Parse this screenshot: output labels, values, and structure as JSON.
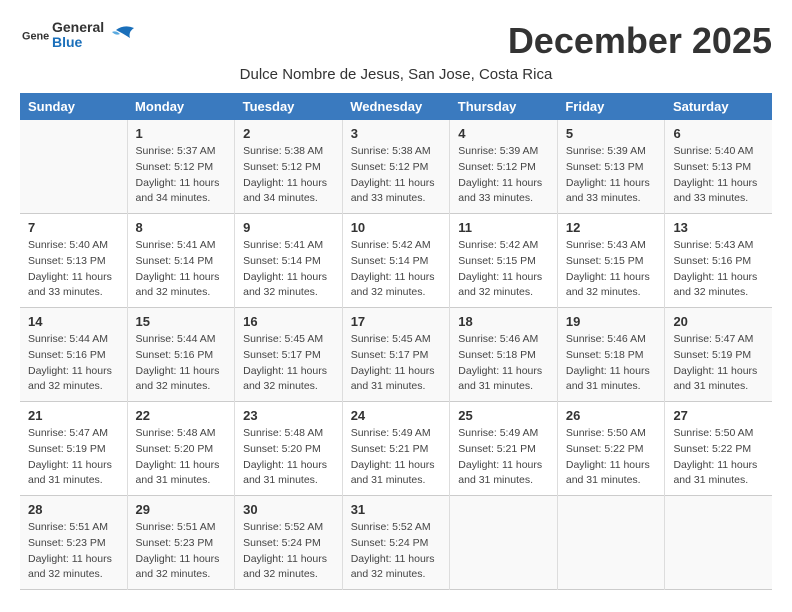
{
  "logo": {
    "general": "General",
    "blue": "Blue"
  },
  "title": "December 2025",
  "subtitle": "Dulce Nombre de Jesus, San Jose, Costa Rica",
  "header": {
    "days": [
      "Sunday",
      "Monday",
      "Tuesday",
      "Wednesday",
      "Thursday",
      "Friday",
      "Saturday"
    ]
  },
  "weeks": [
    {
      "cells": [
        {
          "day": "",
          "content": ""
        },
        {
          "day": "1",
          "content": "Sunrise: 5:37 AM\nSunset: 5:12 PM\nDaylight: 11 hours\nand 34 minutes."
        },
        {
          "day": "2",
          "content": "Sunrise: 5:38 AM\nSunset: 5:12 PM\nDaylight: 11 hours\nand 34 minutes."
        },
        {
          "day": "3",
          "content": "Sunrise: 5:38 AM\nSunset: 5:12 PM\nDaylight: 11 hours\nand 33 minutes."
        },
        {
          "day": "4",
          "content": "Sunrise: 5:39 AM\nSunset: 5:12 PM\nDaylight: 11 hours\nand 33 minutes."
        },
        {
          "day": "5",
          "content": "Sunrise: 5:39 AM\nSunset: 5:13 PM\nDaylight: 11 hours\nand 33 minutes."
        },
        {
          "day": "6",
          "content": "Sunrise: 5:40 AM\nSunset: 5:13 PM\nDaylight: 11 hours\nand 33 minutes."
        }
      ]
    },
    {
      "cells": [
        {
          "day": "7",
          "content": "Sunrise: 5:40 AM\nSunset: 5:13 PM\nDaylight: 11 hours\nand 33 minutes."
        },
        {
          "day": "8",
          "content": "Sunrise: 5:41 AM\nSunset: 5:14 PM\nDaylight: 11 hours\nand 32 minutes."
        },
        {
          "day": "9",
          "content": "Sunrise: 5:41 AM\nSunset: 5:14 PM\nDaylight: 11 hours\nand 32 minutes."
        },
        {
          "day": "10",
          "content": "Sunrise: 5:42 AM\nSunset: 5:14 PM\nDaylight: 11 hours\nand 32 minutes."
        },
        {
          "day": "11",
          "content": "Sunrise: 5:42 AM\nSunset: 5:15 PM\nDaylight: 11 hours\nand 32 minutes."
        },
        {
          "day": "12",
          "content": "Sunrise: 5:43 AM\nSunset: 5:15 PM\nDaylight: 11 hours\nand 32 minutes."
        },
        {
          "day": "13",
          "content": "Sunrise: 5:43 AM\nSunset: 5:16 PM\nDaylight: 11 hours\nand 32 minutes."
        }
      ]
    },
    {
      "cells": [
        {
          "day": "14",
          "content": "Sunrise: 5:44 AM\nSunset: 5:16 PM\nDaylight: 11 hours\nand 32 minutes."
        },
        {
          "day": "15",
          "content": "Sunrise: 5:44 AM\nSunset: 5:16 PM\nDaylight: 11 hours\nand 32 minutes."
        },
        {
          "day": "16",
          "content": "Sunrise: 5:45 AM\nSunset: 5:17 PM\nDaylight: 11 hours\nand 32 minutes."
        },
        {
          "day": "17",
          "content": "Sunrise: 5:45 AM\nSunset: 5:17 PM\nDaylight: 11 hours\nand 31 minutes."
        },
        {
          "day": "18",
          "content": "Sunrise: 5:46 AM\nSunset: 5:18 PM\nDaylight: 11 hours\nand 31 minutes."
        },
        {
          "day": "19",
          "content": "Sunrise: 5:46 AM\nSunset: 5:18 PM\nDaylight: 11 hours\nand 31 minutes."
        },
        {
          "day": "20",
          "content": "Sunrise: 5:47 AM\nSunset: 5:19 PM\nDaylight: 11 hours\nand 31 minutes."
        }
      ]
    },
    {
      "cells": [
        {
          "day": "21",
          "content": "Sunrise: 5:47 AM\nSunset: 5:19 PM\nDaylight: 11 hours\nand 31 minutes."
        },
        {
          "day": "22",
          "content": "Sunrise: 5:48 AM\nSunset: 5:20 PM\nDaylight: 11 hours\nand 31 minutes."
        },
        {
          "day": "23",
          "content": "Sunrise: 5:48 AM\nSunset: 5:20 PM\nDaylight: 11 hours\nand 31 minutes."
        },
        {
          "day": "24",
          "content": "Sunrise: 5:49 AM\nSunset: 5:21 PM\nDaylight: 11 hours\nand 31 minutes."
        },
        {
          "day": "25",
          "content": "Sunrise: 5:49 AM\nSunset: 5:21 PM\nDaylight: 11 hours\nand 31 minutes."
        },
        {
          "day": "26",
          "content": "Sunrise: 5:50 AM\nSunset: 5:22 PM\nDaylight: 11 hours\nand 31 minutes."
        },
        {
          "day": "27",
          "content": "Sunrise: 5:50 AM\nSunset: 5:22 PM\nDaylight: 11 hours\nand 31 minutes."
        }
      ]
    },
    {
      "cells": [
        {
          "day": "28",
          "content": "Sunrise: 5:51 AM\nSunset: 5:23 PM\nDaylight: 11 hours\nand 32 minutes."
        },
        {
          "day": "29",
          "content": "Sunrise: 5:51 AM\nSunset: 5:23 PM\nDaylight: 11 hours\nand 32 minutes."
        },
        {
          "day": "30",
          "content": "Sunrise: 5:52 AM\nSunset: 5:24 PM\nDaylight: 11 hours\nand 32 minutes."
        },
        {
          "day": "31",
          "content": "Sunrise: 5:52 AM\nSunset: 5:24 PM\nDaylight: 11 hours\nand 32 minutes."
        },
        {
          "day": "",
          "content": ""
        },
        {
          "day": "",
          "content": ""
        },
        {
          "day": "",
          "content": ""
        }
      ]
    }
  ]
}
